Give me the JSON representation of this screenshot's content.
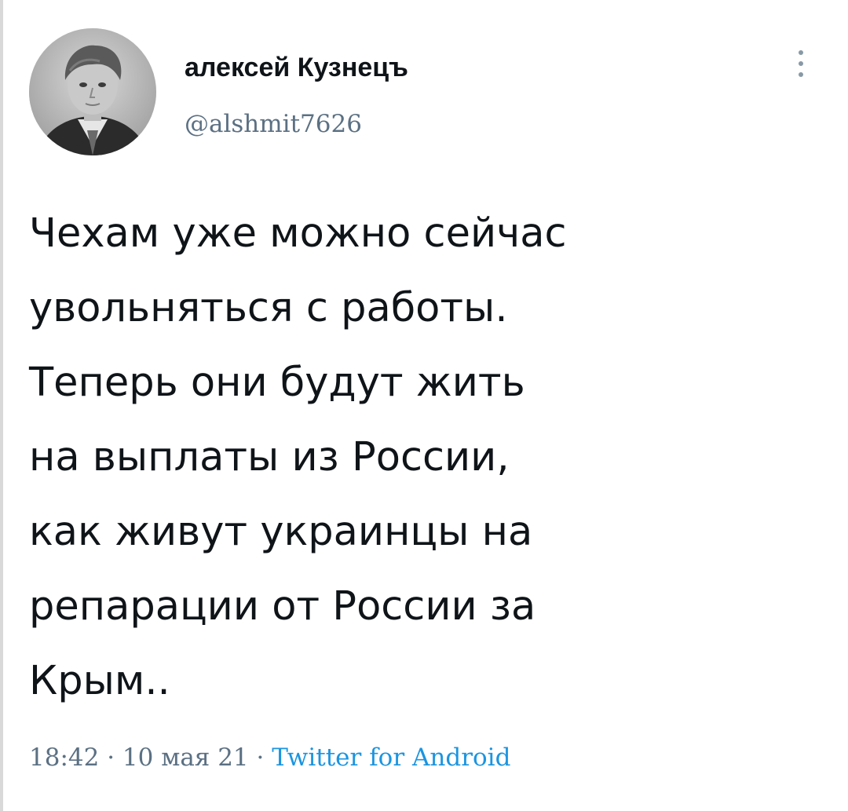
{
  "author": {
    "display_name": "алексей Кузнецъ",
    "handle": "@alshmit7626",
    "avatar_icon": "user-avatar-photo"
  },
  "menu": {
    "icon": "more-vertical-icon"
  },
  "tweet": {
    "lines": [
      "Чехам уже можно сейчас",
      "увольняться с работы.",
      "Теперь они будут жить",
      "на выплаты из России,",
      "как живут украинцы на",
      "репарации от России за",
      "Крым.."
    ]
  },
  "meta": {
    "time": "18:42",
    "separator": " · ",
    "date": "10 мая 21",
    "source": "Twitter for Android"
  },
  "colors": {
    "text": "#0f1419",
    "secondary": "#5b7083",
    "link": "#1b95e0"
  }
}
